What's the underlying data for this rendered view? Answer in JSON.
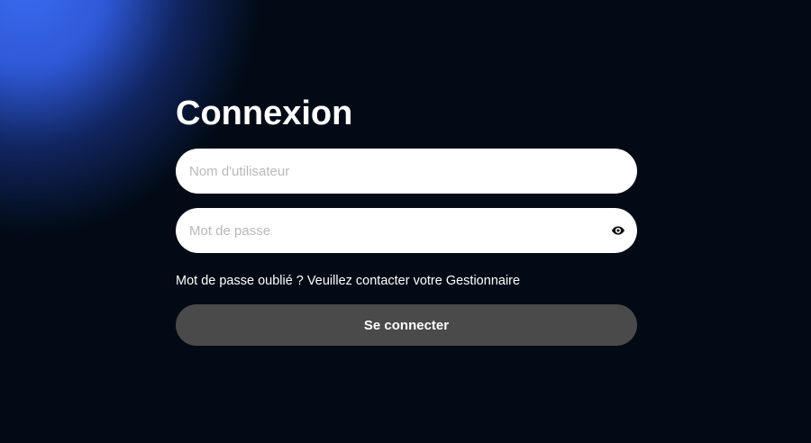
{
  "login": {
    "title": "Connexion",
    "username": {
      "value": "",
      "placeholder": "Nom d'utilisateur"
    },
    "password": {
      "value": "",
      "placeholder": "Mot de passe",
      "toggle_icon": "eye-icon"
    },
    "help_text": "Mot de passe oublié ? Veuillez contacter votre Gestionnaire",
    "submit_label": "Se connecter"
  },
  "colors": {
    "background": "#020b15",
    "accent_glow": "#3a6cf0",
    "button": "#4a4a4a",
    "input": "#ffffff"
  }
}
